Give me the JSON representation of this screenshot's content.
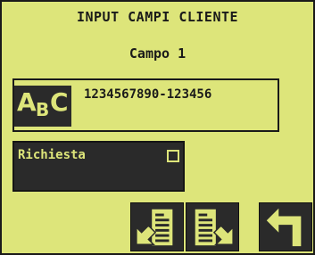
{
  "header": {
    "title": "INPUT CAMPI CLIENTE",
    "subtitle": "Campo 1"
  },
  "field": {
    "icon": "abc-text-icon",
    "icon_letters": [
      "A",
      "B",
      "C"
    ],
    "value": "1234567890-123456"
  },
  "required": {
    "label": "Richiesta",
    "checked": false
  },
  "buttons": [
    {
      "icon": "previous-field-icon"
    },
    {
      "icon": "next-field-icon"
    },
    {
      "icon": "back-return-icon"
    }
  ],
  "colors": {
    "background": "#dde57a",
    "dark": "#2a2a2a"
  }
}
